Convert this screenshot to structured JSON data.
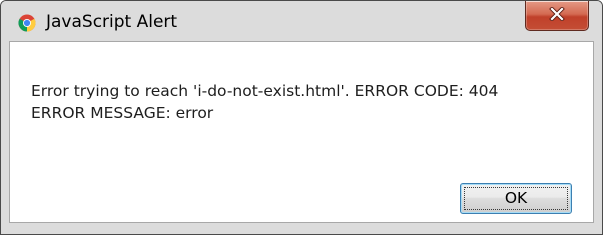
{
  "dialog": {
    "title": "JavaScript Alert",
    "app_icon": "chrome-icon",
    "close_icon": "close-icon",
    "message_lines": [
      "Error trying to reach 'i-do-not-exist.html'. ERROR CODE: 404",
      "ERROR MESSAGE: error"
    ],
    "ok_label": "OK"
  },
  "colors": {
    "frame": "#dcdcdc",
    "close_button": "#c44e35",
    "content_background": "#ffffff",
    "ok_border": "#3c7fb1"
  }
}
